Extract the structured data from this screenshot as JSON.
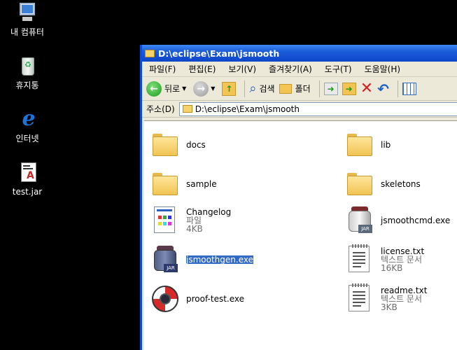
{
  "desktop": {
    "icons": [
      {
        "label": "내 컴퓨터",
        "icon": "my-computer-icon"
      },
      {
        "label": "휴지통",
        "icon": "recycle-bin-icon"
      },
      {
        "label": "인터넷",
        "icon": "internet-explorer-icon"
      },
      {
        "label": "test.jar",
        "icon": "jar-file-icon"
      }
    ]
  },
  "window": {
    "title": "D:\\eclipse\\Exam\\jsmooth",
    "menu": [
      "파일(F)",
      "편집(E)",
      "보기(V)",
      "즐겨찾기(A)",
      "도구(T)",
      "도움말(H)"
    ],
    "toolbar": {
      "back": "뒤로",
      "search": "검색",
      "folders": "폴더"
    },
    "address": {
      "label": "주소(D)",
      "value": "D:\\eclipse\\Exam\\jsmooth"
    }
  },
  "files": [
    {
      "name": "docs",
      "type": "folder"
    },
    {
      "name": "lib",
      "type": "folder"
    },
    {
      "name": "sample",
      "type": "folder"
    },
    {
      "name": "skeletons",
      "type": "folder"
    },
    {
      "name": "Changelog",
      "line2": "파일",
      "line3": "4KB",
      "type": "file"
    },
    {
      "name": "jsmoothcmd.exe",
      "type": "exe"
    },
    {
      "name": "jsmoothgen.exe",
      "type": "exe",
      "selected": true
    },
    {
      "name": "license.txt",
      "line2": "텍스트 문서",
      "line3": "16KB",
      "type": "txt"
    },
    {
      "name": "proof-test.exe",
      "type": "lifebuoy"
    },
    {
      "name": "readme.txt",
      "line2": "텍스트 문서",
      "line3": "3KB",
      "type": "txt"
    }
  ],
  "colors": {
    "titlebar": "#1b5bd8",
    "selection": "#316ac5",
    "desktop": "#000000"
  }
}
